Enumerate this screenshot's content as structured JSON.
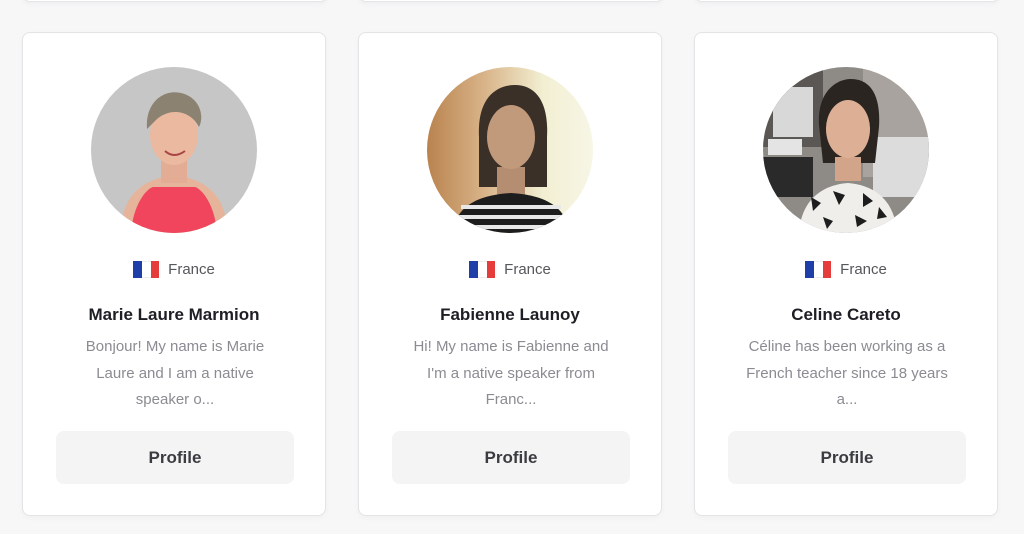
{
  "teachers": [
    {
      "country": "France",
      "flag_icon": "france-flag-icon",
      "name": "Marie Laure Marmion",
      "bio_lines": [
        "Bonjour! My name is Marie",
        "Laure and I am a native",
        "speaker o..."
      ],
      "button_label": "Profile"
    },
    {
      "country": "France",
      "flag_icon": "france-flag-icon",
      "name": "Fabienne Launoy",
      "bio_lines": [
        "Hi! My name is Fabienne and",
        "I'm a native speaker from",
        "Franc..."
      ],
      "button_label": "Profile"
    },
    {
      "country": "France",
      "flag_icon": "france-flag-icon",
      "name": "Celine Careto",
      "bio_lines": [
        "Céline has been working as a",
        "French teacher since 18 years",
        "a..."
      ],
      "button_label": "Profile"
    }
  ],
  "colors": {
    "flag_blue": "#1f3fa8",
    "flag_white": "#ffffff",
    "flag_red": "#e53c3c",
    "button_bg": "#f4f4f5"
  }
}
